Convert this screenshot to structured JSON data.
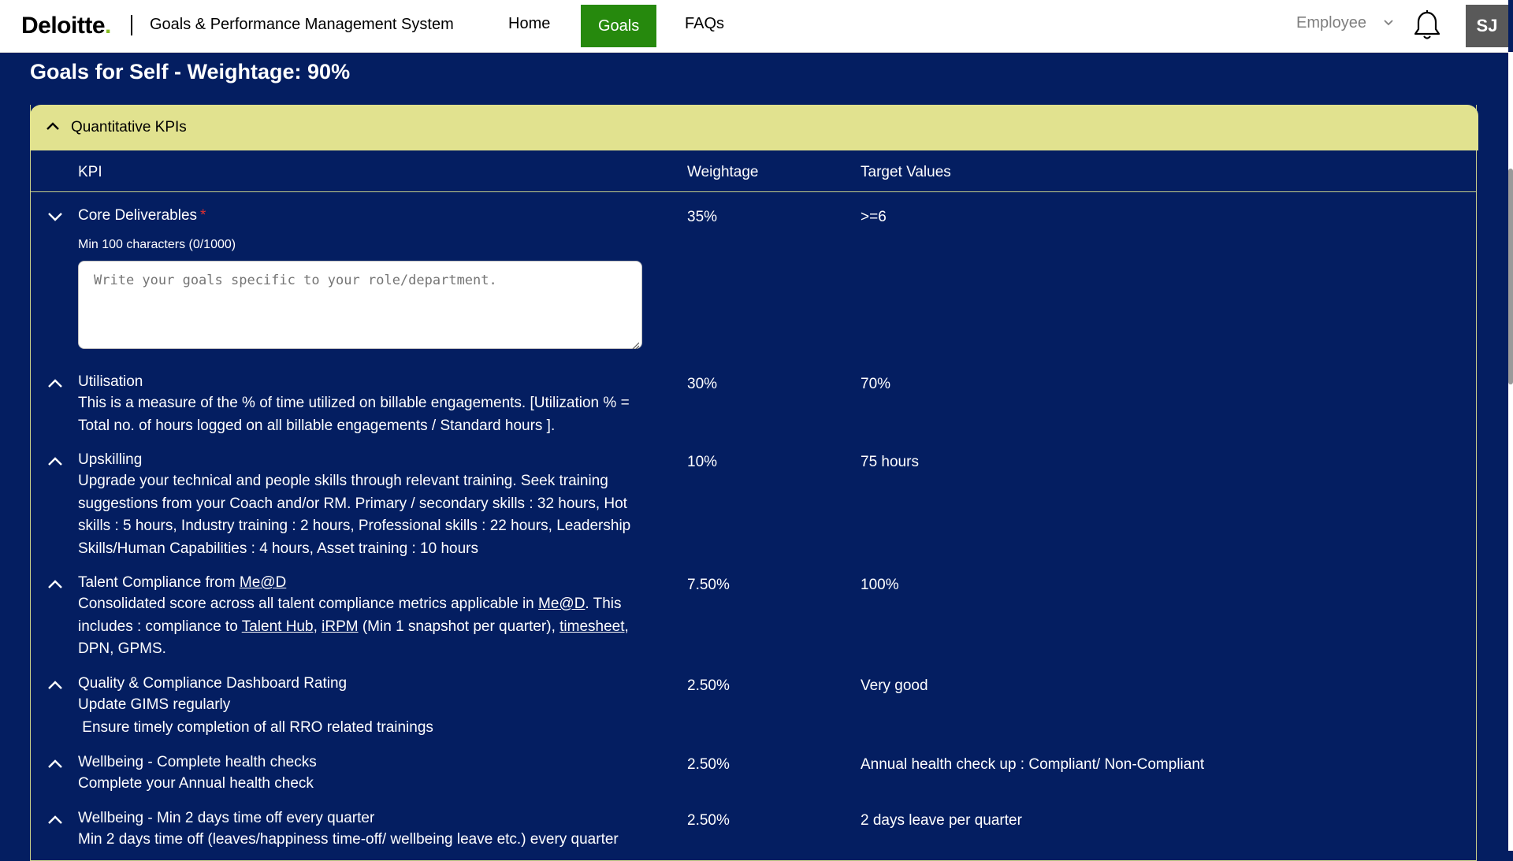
{
  "header": {
    "brand": "Deloitte",
    "brand_dot": ".",
    "app_title": "Goals & Performance Management System",
    "nav": [
      {
        "label": "Home",
        "active": false
      },
      {
        "label": "Goals",
        "active": true
      },
      {
        "label": "FAQs",
        "active": false
      }
    ],
    "role_select": {
      "value": "Employee"
    },
    "notifications_icon": "bell-icon",
    "avatar_initials": "SJ"
  },
  "page": {
    "section_title": "Goals for Self - Weightage: 90%",
    "accordion": {
      "title": "Quantitative KPIs",
      "expanded": true,
      "columns": [
        "KPI",
        "Weightage",
        "Target Values"
      ]
    }
  },
  "kpis": [
    {
      "title": "Core Deliverables",
      "required_marker": "*",
      "weightage": "35%",
      "target": ">=6",
      "hint": "Min 100 characters (0/1000)",
      "input_placeholder": "Write your goals specific to your role/department.",
      "input_value": ""
    },
    {
      "title": "Utilisation",
      "desc_lines": [
        "This is a measure of the % of time utilized on billable engagements. [Utilization % =",
        "Total no. of hours logged on all billable engagements / Standard hours ]."
      ],
      "weightage": "30%",
      "target": "70%"
    },
    {
      "title": "Upskilling",
      "desc_lines": [
        "Upgrade your technical and people skills through relevant training. Seek training",
        "suggestions from your Coach and/or RM. Primary / secondary skills : 32 hours, Hot",
        "skills : 5 hours, Industry training : 2 hours, Professional skills :  22 hours, Leadership",
        "Skills/Human Capabilities : 4 hours, Asset training : 10 hours"
      ],
      "weightage": "10%",
      "target": "75 hours"
    },
    {
      "title_prefix": "Talent Compliance from ",
      "title_link": "Me@D",
      "desc": {
        "p1": "Consolidated score across all talent compliance metrics applicable in ",
        "link1": "Me@D",
        "p2": ". This",
        "p3": "includes : compliance to ",
        "link2": "Talent Hub",
        "p4": ", ",
        "link3": "iRPM",
        "p5": " (Min 1 snapshot per quarter), ",
        "link4": "timesheet",
        "p6": ",",
        "p7": "DPN, GPMS."
      },
      "weightage": "7.50%",
      "target": "100%"
    },
    {
      "title": "Quality & Compliance Dashboard Rating",
      "desc_lines": [
        "Update GIMS regularly",
        " Ensure timely completion of all RRO related trainings"
      ],
      "weightage": "2.50%",
      "target": "Very good"
    },
    {
      "title": "Wellbeing - Complete health checks",
      "desc_lines": [
        "Complete your Annual health check"
      ],
      "weightage": "2.50%",
      "target": "Annual health check up : Compliant/ Non-Compliant"
    },
    {
      "title": "Wellbeing - Min 2 days time off every quarter",
      "desc_lines": [
        "Min 2 days time off (leaves/happiness time-off/ wellbeing leave etc.) every quarter"
      ],
      "weightage": "2.50%",
      "target": "2 days leave per quarter"
    }
  ],
  "colors": {
    "page_bg": "#041e61",
    "accent_green": "#26890d",
    "brand_green": "#86bc25",
    "accordion_header": "#e1e28f",
    "required": "#e03030"
  }
}
